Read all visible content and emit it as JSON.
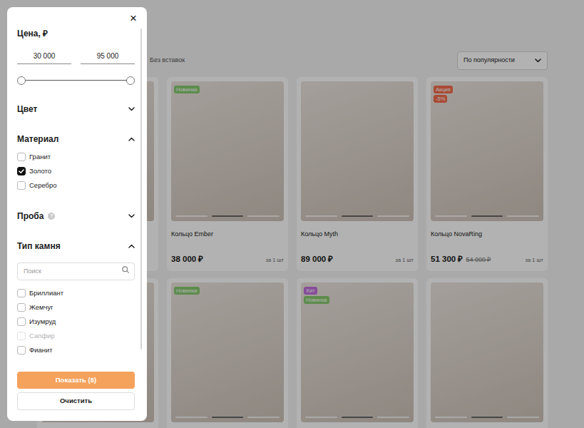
{
  "filter": {
    "close": "×",
    "sections": [
      {
        "kind": "price",
        "title": "Цена, ₽",
        "min": "30 000",
        "max": "95 000",
        "low": 0,
        "high": 1
      },
      {
        "kind": "collapsed",
        "title": "Цвет",
        "expanded": false
      },
      {
        "kind": "checklist",
        "title": "Материал",
        "expanded": true,
        "options": [
          {
            "label": "Гранит",
            "checked": false,
            "disabled": false
          },
          {
            "label": "Золото",
            "checked": true,
            "disabled": false
          },
          {
            "label": "Серебро",
            "checked": false,
            "disabled": false
          }
        ]
      },
      {
        "kind": "collapsed",
        "title": "Проба",
        "hint": "?",
        "expanded": false
      },
      {
        "kind": "searchlist",
        "title": "Тип камня",
        "expanded": true,
        "search": {
          "placeholder": "Поиск"
        },
        "options": [
          {
            "label": "Бриллиант",
            "checked": false,
            "disabled": false
          },
          {
            "label": "Жемчуг",
            "checked": false,
            "disabled": false
          },
          {
            "label": "Изумруд",
            "checked": false,
            "disabled": false
          },
          {
            "label": "Сапфир",
            "checked": false,
            "disabled": true
          },
          {
            "label": "Фианит",
            "checked": false,
            "disabled": false
          }
        ]
      }
    ],
    "apply": "Показать (8)",
    "clear": "Очистить"
  },
  "page": {
    "chips": [
      "Без вставок"
    ],
    "sort": "По популярности",
    "products": [
      {
        "badges": [],
        "slides": []
      },
      {
        "badges": [
          {
            "label": "Новинка",
            "color": "#86c96f"
          }
        ],
        "title": "Кольцо Ember",
        "price": "38 000 ₽",
        "unit": "за 1 шт",
        "slides": [
          false,
          true,
          false
        ]
      },
      {
        "badges": [],
        "title": "Кольцо Myth",
        "price": "89 000 ₽",
        "unit": "за 1 шт",
        "slides": [
          false,
          true,
          false
        ]
      },
      {
        "badges": [
          {
            "label": "Акция",
            "color": "#f26b4b"
          },
          {
            "label": "-5%",
            "color": "#f26b4b"
          }
        ],
        "title": "Кольцо NovaRing",
        "price": "51 300 ₽",
        "old_price": "54 000 ₽",
        "unit": "за 1 шт",
        "slides": [
          false,
          true,
          false
        ]
      },
      {
        "badges": [],
        "slides": []
      },
      {
        "badges": [
          {
            "label": "Новинка",
            "color": "#86c96f"
          }
        ],
        "slides": [
          false,
          true,
          false
        ]
      },
      {
        "badges": [
          {
            "label": "Хит",
            "color": "#c06fdc"
          },
          {
            "label": "Новинка",
            "color": "#86c96f"
          }
        ],
        "slides": [
          false,
          true,
          false
        ]
      },
      {
        "badges": [],
        "slides": [
          false,
          true,
          false
        ]
      }
    ]
  }
}
